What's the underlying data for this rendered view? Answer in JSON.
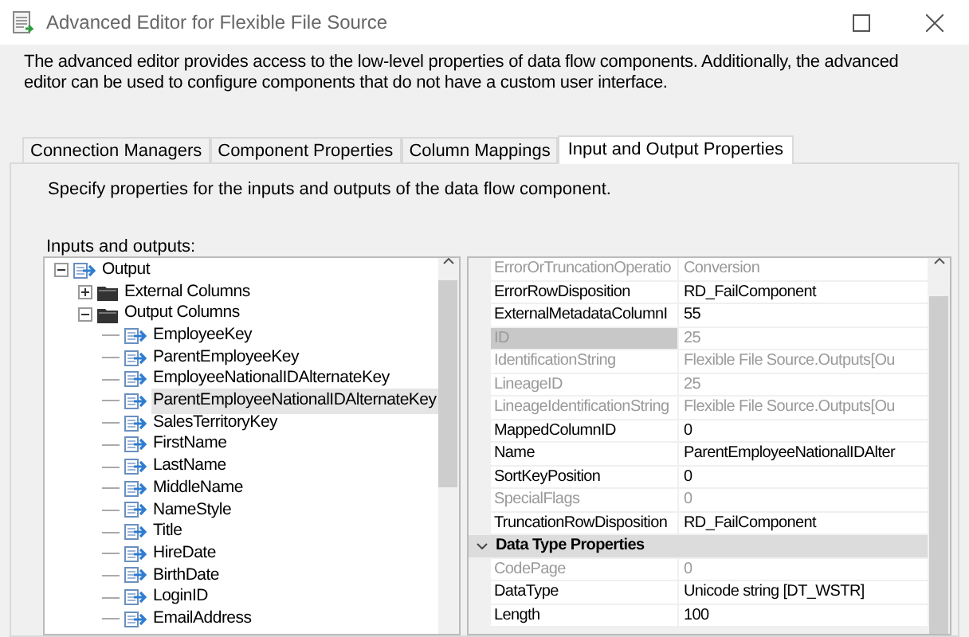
{
  "window": {
    "title": "Advanced Editor for Flexible File Source"
  },
  "description": "The advanced editor provides access to the low-level properties of data flow components. Additionally, the advanced editor can be used to configure components that do not have a custom user interface.",
  "tabs": [
    {
      "label": "Connection Managers",
      "selected": false
    },
    {
      "label": "Component Properties",
      "selected": false
    },
    {
      "label": "Column Mappings",
      "selected": false
    },
    {
      "label": "Input and Output Properties",
      "selected": true
    }
  ],
  "instruction": "Specify properties for the inputs and outputs of the data flow component.",
  "tree_label": "Inputs and outputs:",
  "tree": [
    {
      "label": "Output",
      "kind": "output",
      "expanded": true,
      "selected": false,
      "children": [
        {
          "label": "External Columns",
          "kind": "folder",
          "expanded": false,
          "selected": false
        },
        {
          "label": "Output Columns",
          "kind": "folder",
          "expanded": true,
          "selected": false,
          "children": [
            {
              "label": "EmployeeKey",
              "kind": "column",
              "selected": false
            },
            {
              "label": "ParentEmployeeKey",
              "kind": "column",
              "selected": false
            },
            {
              "label": "EmployeeNationalIDAlternateKey",
              "kind": "column",
              "selected": false
            },
            {
              "label": "ParentEmployeeNationalIDAlternateKey",
              "kind": "column",
              "selected": true
            },
            {
              "label": "SalesTerritoryKey",
              "kind": "column",
              "selected": false
            },
            {
              "label": "FirstName",
              "kind": "column",
              "selected": false
            },
            {
              "label": "LastName",
              "kind": "column",
              "selected": false
            },
            {
              "label": "MiddleName",
              "kind": "column",
              "selected": false
            },
            {
              "label": "NameStyle",
              "kind": "column",
              "selected": false
            },
            {
              "label": "Title",
              "kind": "column",
              "selected": false
            },
            {
              "label": "HireDate",
              "kind": "column",
              "selected": false
            },
            {
              "label": "BirthDate",
              "kind": "column",
              "selected": false
            },
            {
              "label": "LoginID",
              "kind": "column",
              "selected": false
            },
            {
              "label": "EmailAddress",
              "kind": "column",
              "selected": false
            }
          ]
        }
      ]
    }
  ],
  "properties": [
    {
      "kind": "property",
      "name": "ErrorOrTruncationOperatio",
      "value": "Conversion",
      "disabled": true,
      "selected": false
    },
    {
      "kind": "property",
      "name": "ErrorRowDisposition",
      "value": "RD_FailComponent",
      "disabled": false,
      "selected": false
    },
    {
      "kind": "property",
      "name": "ExternalMetadataColumnI",
      "value": "55",
      "disabled": false,
      "selected": false
    },
    {
      "kind": "property",
      "name": "ID",
      "value": "25",
      "disabled": true,
      "selected": true
    },
    {
      "kind": "property",
      "name": "IdentificationString",
      "value": "Flexible File Source.Outputs[Ou",
      "disabled": true,
      "selected": false
    },
    {
      "kind": "property",
      "name": "LineageID",
      "value": "25",
      "disabled": true,
      "selected": false
    },
    {
      "kind": "property",
      "name": "LineageIdentificationString",
      "value": "Flexible File Source.Outputs[Ou",
      "disabled": true,
      "selected": false
    },
    {
      "kind": "property",
      "name": "MappedColumnID",
      "value": "0",
      "disabled": false,
      "selected": false
    },
    {
      "kind": "property",
      "name": "Name",
      "value": "ParentEmployeeNationalIDAlter",
      "disabled": false,
      "selected": false
    },
    {
      "kind": "property",
      "name": "SortKeyPosition",
      "value": "0",
      "disabled": false,
      "selected": false
    },
    {
      "kind": "property",
      "name": "SpecialFlags",
      "value": "0",
      "disabled": true,
      "selected": false
    },
    {
      "kind": "property",
      "name": "TruncationRowDisposition",
      "value": "RD_FailComponent",
      "disabled": false,
      "selected": false
    },
    {
      "kind": "category",
      "name": "Data Type Properties",
      "expanded": true
    },
    {
      "kind": "property",
      "name": "CodePage",
      "value": "0",
      "disabled": true,
      "selected": false
    },
    {
      "kind": "property",
      "name": "DataType",
      "value": "Unicode string [DT_WSTR]",
      "disabled": false,
      "selected": false
    },
    {
      "kind": "property",
      "name": "Length",
      "value": "100",
      "disabled": false,
      "selected": false
    }
  ]
}
